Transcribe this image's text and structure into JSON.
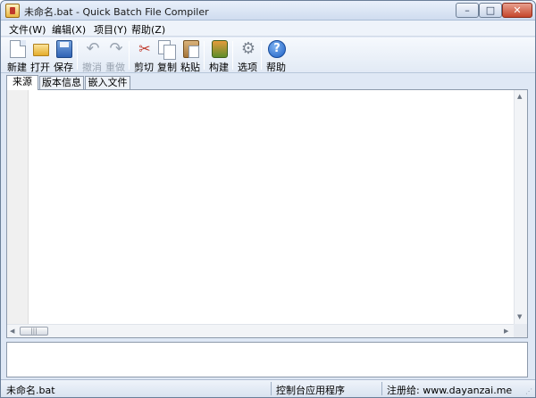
{
  "window": {
    "title": "未命名.bat - Quick Batch File Compiler",
    "minimize_glyph": "–",
    "maximize_glyph": "□",
    "close_glyph": "✕"
  },
  "menu": {
    "file": "文件(W)",
    "edit": "编辑(X)",
    "project": "项目(Y)",
    "help": "帮助(Z)"
  },
  "toolbar": {
    "new": "新建",
    "open": "打开",
    "save": "保存",
    "undo": "撤消",
    "redo": "重做",
    "cut": "剪切",
    "copy": "复制",
    "paste": "粘贴",
    "build": "构建",
    "options": "选项",
    "help": "帮助",
    "help_glyph": "?",
    "undo_glyph": "↶",
    "redo_glyph": "↷",
    "cut_glyph": "✂",
    "options_glyph": "⚙"
  },
  "icons": {
    "new": "new-file-icon",
    "open": "folder-open-icon",
    "save": "floppy-disk-icon",
    "undo": "undo-icon",
    "redo": "redo-icon",
    "cut": "scissors-icon",
    "copy": "copy-icon",
    "paste": "clipboard-icon",
    "build": "build-icon",
    "options": "gear-icon",
    "help": "help-icon"
  },
  "tabs": [
    {
      "label": "来源",
      "active": true
    },
    {
      "label": "版本信息",
      "active": false
    },
    {
      "label": "嵌入文件",
      "active": false
    }
  ],
  "editor": {
    "scroll_up": "▲",
    "scroll_down": "▼",
    "scroll_left": "◀",
    "scroll_right": "▶",
    "thumb_grip": "|||"
  },
  "status": {
    "file": "未命名.bat",
    "type": "控制台应用程序",
    "registered": "注册给: www.dayanzai.me",
    "grip": "⋰"
  }
}
